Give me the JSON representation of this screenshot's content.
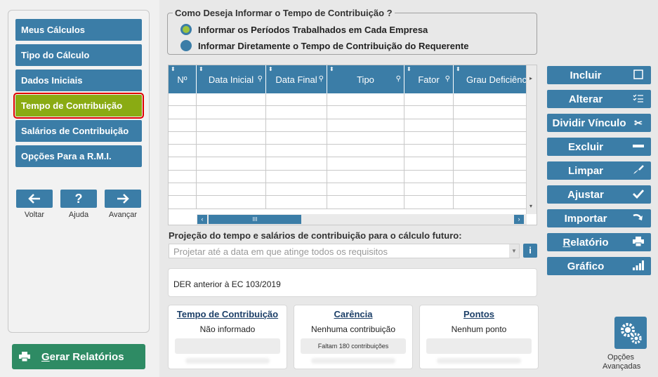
{
  "sidebar": {
    "items": [
      {
        "label": "Meus Cálculos"
      },
      {
        "label": "Tipo do Cálculo"
      },
      {
        "label": "Dados Iniciais"
      },
      {
        "label": "Tempo de Contribuição",
        "active": true
      },
      {
        "label": "Salários de Contribuição"
      },
      {
        "label": "Opções Para a R.M.I."
      }
    ],
    "back_label": "Voltar",
    "help_label": "Ajuda",
    "help_glyph": "?",
    "forward_label": "Avançar",
    "generate_label": "Gerar Relatórios",
    "generate_mnemonic": "G",
    "generate_rest": "erar Relatórios"
  },
  "contribution_input": {
    "title": "Como Deseja Informar o Tempo de Contribuição ?",
    "options": [
      {
        "label": "Informar os Períodos Trabalhados em Cada Empresa",
        "selected": true
      },
      {
        "label": "Informar Diretamente o Tempo de Contribuição do Requerente",
        "selected": false
      }
    ]
  },
  "grid": {
    "columns": [
      "Nº",
      "Data Inicial",
      "Data Final",
      "Tipo",
      "Fator",
      "Grau Deficiênci"
    ],
    "rows": []
  },
  "projection": {
    "label": "Projeção do tempo e salários de contribuição para o cálculo futuro:",
    "placeholder": "Projetar até a data em que atinge todos os requisitos",
    "info_glyph": "i"
  },
  "der": {
    "text": "DER anterior à EC 103/2019"
  },
  "summary": [
    {
      "title": "Tempo de Contribuição",
      "value": "Não informado",
      "bar": ""
    },
    {
      "title": "Carência",
      "value": "Nenhuma contribuição",
      "bar": "Faltam 180 contribuições"
    },
    {
      "title": "Pontos",
      "value": "Nenhum ponto",
      "bar": ""
    }
  ],
  "actions": {
    "include": "Incluir",
    "edit": "Alterar",
    "split": "Dividir Vínculo",
    "delete": "Excluir",
    "clear": "Limpar",
    "adjust": "Ajustar",
    "import": "Importar",
    "report": "Relatório",
    "report_mnemonic": "R",
    "report_rest": "elatório",
    "chart": "Gráfico"
  },
  "advanced": {
    "label_line1": "Opções",
    "label_line2": "Avançadas"
  },
  "colors": {
    "primary": "#3b7da7",
    "active": "#8aab13",
    "generate": "#2e8b64",
    "title_text": "#1c3f68"
  }
}
